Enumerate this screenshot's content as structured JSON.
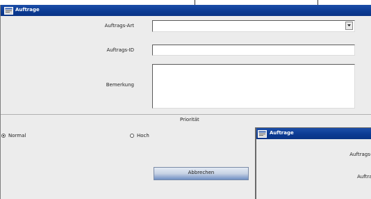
{
  "window": {
    "title": "Auftrage",
    "fields": {
      "auftrags_art_label": "Auftrags-Art",
      "auftrags_art_value": "",
      "auftrags_id_label": "Auftrags-ID",
      "auftrags_id_value": "",
      "bemerkung_label": "Bemerkung",
      "bemerkung_value": ""
    },
    "priority": {
      "heading": "Priorität",
      "options": [
        {
          "label": "Normal",
          "selected": true
        },
        {
          "label": "Hoch",
          "selected": false
        }
      ]
    },
    "submit_label": "Abbrechen"
  },
  "window2": {
    "title": "Auftrage",
    "labels": [
      "Auftrags-A",
      "Auftrag"
    ]
  },
  "colors": {
    "titlebar": "#0b3a92",
    "window_bg": "#ececec",
    "button_accent": "#6f8fc4"
  },
  "icons": {
    "window_icon": "window-app-icon",
    "dropdown_icon": "chevron-down-icon"
  }
}
